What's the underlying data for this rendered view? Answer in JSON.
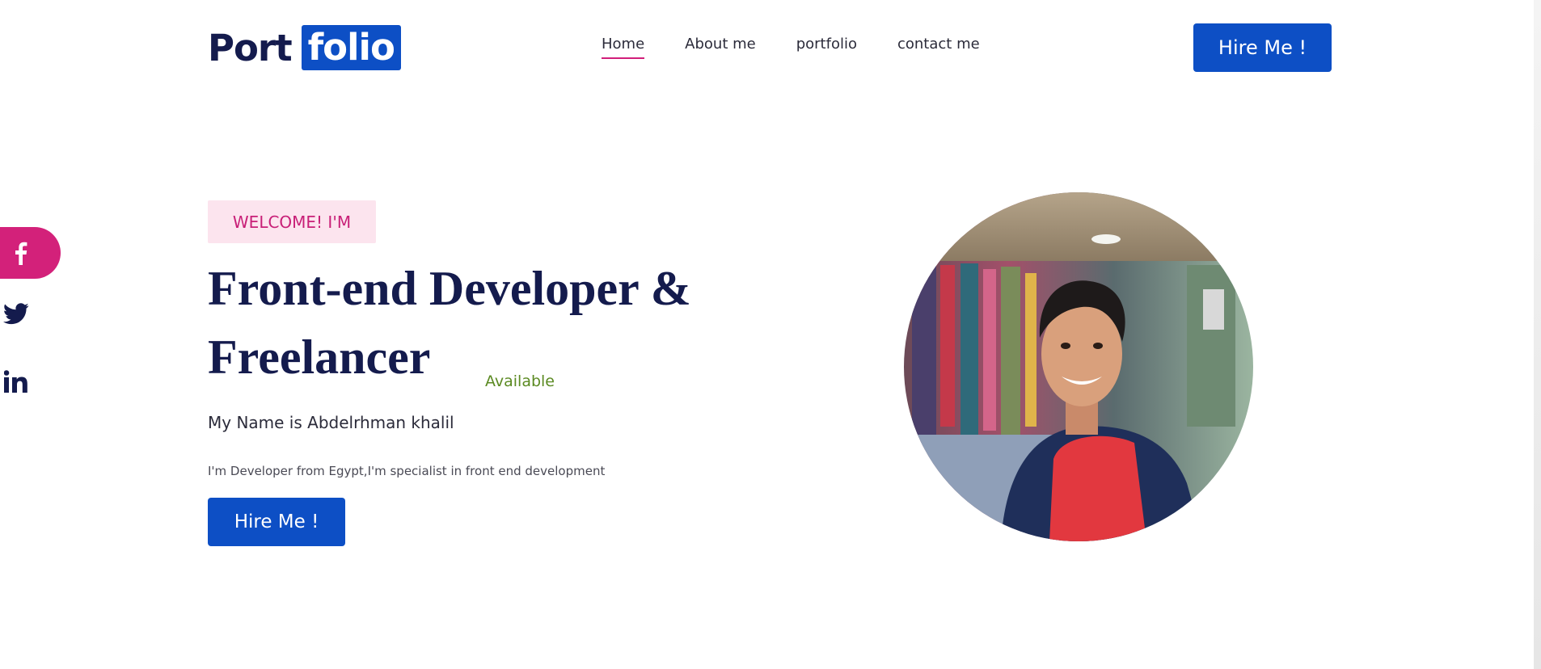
{
  "header": {
    "logo_part1": "Port",
    "logo_part2": "folio",
    "nav": [
      {
        "label": "Home",
        "active": true
      },
      {
        "label": "About me",
        "active": false
      },
      {
        "label": "portfolio",
        "active": false
      },
      {
        "label": "contact me",
        "active": false
      }
    ],
    "hire_label": "Hire Me !"
  },
  "social": {
    "icons": [
      "facebook-icon",
      "twitter-icon",
      "linkedin-icon"
    ]
  },
  "hero": {
    "welcome": "WELCOME! I'M",
    "headline_line1": "Front-end Developer &",
    "headline_line2": "Freelancer",
    "available": "Available",
    "my_name": "My Name is Abdelrhman khalil",
    "description": "I'm Developer from Egypt,I'm specialist in front end development",
    "hire_label": "Hire Me !"
  },
  "colors": {
    "primary": "#0d4fc5",
    "accent": "#d3217a",
    "heading": "#141b4d",
    "badge_bg": "#fce4ee",
    "available": "#5b8a22"
  }
}
